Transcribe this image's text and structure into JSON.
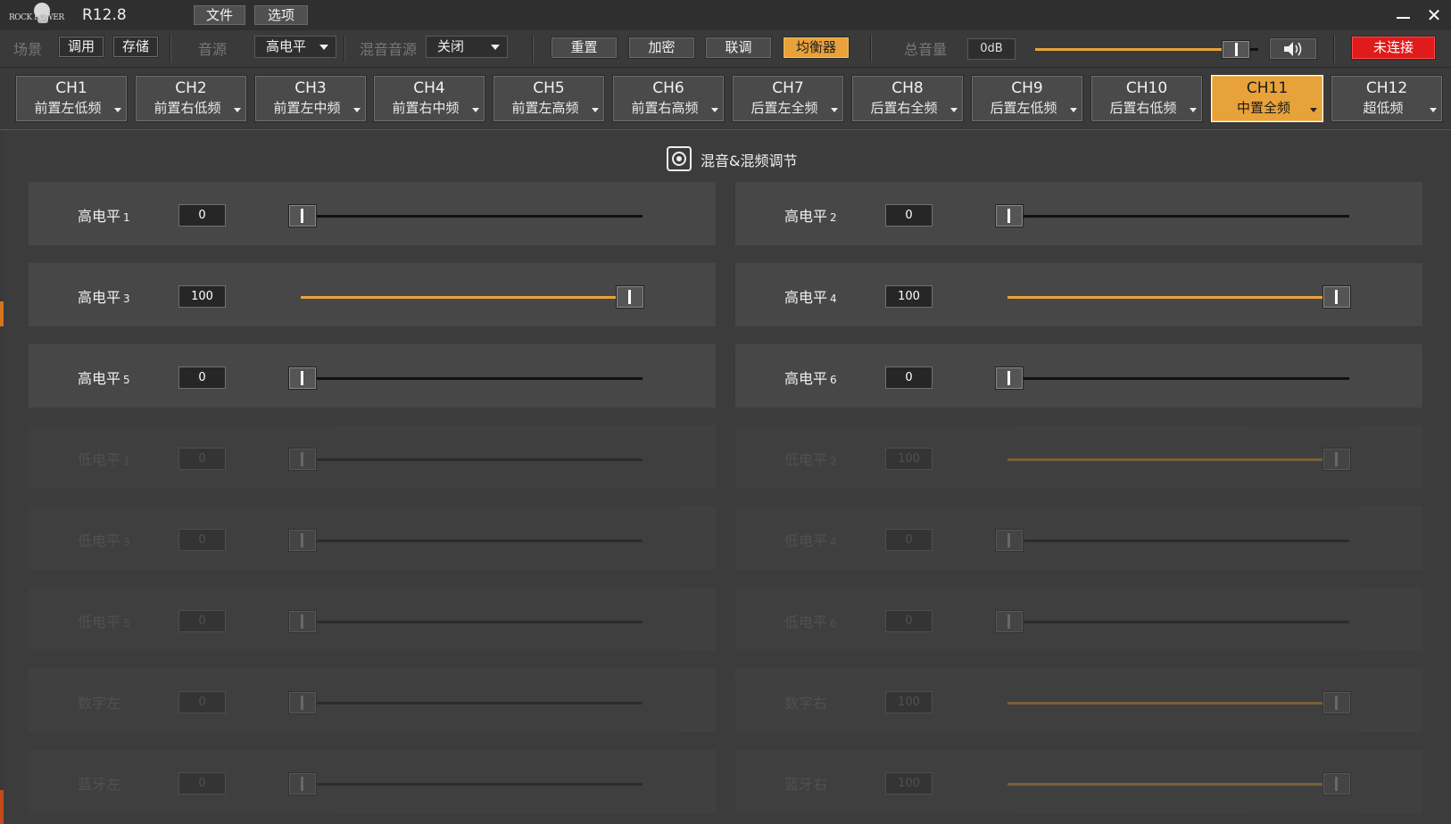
{
  "titlebar": {
    "logo_text": "ROCK POWER",
    "version": "R12.8",
    "menu": [
      "文件",
      "选项"
    ]
  },
  "toolbar": {
    "scene_label": "场景",
    "recall_btn": "调用",
    "store_btn": "存储",
    "source_label": "音源",
    "source_value": "高电平",
    "mix_source_label": "混音音源",
    "mix_source_value": "关闭",
    "reset_btn": "重置",
    "encrypt_btn": "加密",
    "link_btn": "联调",
    "eq_btn": "均衡器",
    "master_volume_label": "总音量",
    "master_volume_value": "0dB",
    "master_volume_level": 0.85,
    "connect_btn": "未连接",
    "colors": {
      "accent": "#e8a23a",
      "danger": "#e11b1b"
    }
  },
  "channels": [
    {
      "name": "CH1",
      "sub": "前置左低频"
    },
    {
      "name": "CH2",
      "sub": "前置右低频"
    },
    {
      "name": "CH3",
      "sub": "前置左中频"
    },
    {
      "name": "CH4",
      "sub": "前置右中频"
    },
    {
      "name": "CH5",
      "sub": "前置左高频"
    },
    {
      "name": "CH6",
      "sub": "前置右高频"
    },
    {
      "name": "CH7",
      "sub": "后置左全频"
    },
    {
      "name": "CH8",
      "sub": "后置右全频"
    },
    {
      "name": "CH9",
      "sub": "后置左低频"
    },
    {
      "name": "CH10",
      "sub": "后置右低频"
    },
    {
      "name": "CH11",
      "sub": "中置全频",
      "active": true
    },
    {
      "name": "CH12",
      "sub": "超低频"
    }
  ],
  "panel": {
    "title": "混音&混频调节",
    "rows": [
      {
        "left": {
          "label": "高电平",
          "num": "1",
          "value": "0",
          "level": 0
        },
        "right": {
          "label": "高电平",
          "num": "2",
          "value": "0",
          "level": 0
        }
      },
      {
        "left": {
          "label": "高电平",
          "num": "3",
          "value": "100",
          "level": 100
        },
        "right": {
          "label": "高电平",
          "num": "4",
          "value": "100",
          "level": 100
        }
      },
      {
        "left": {
          "label": "高电平",
          "num": "5",
          "value": "0",
          "level": 0
        },
        "right": {
          "label": "高电平",
          "num": "6",
          "value": "0",
          "level": 0
        }
      },
      {
        "disabled": true,
        "left": {
          "label": "低电平",
          "num": "1",
          "value": "0",
          "level": 0
        },
        "right": {
          "label": "低电平",
          "num": "2",
          "value": "100",
          "level": 100
        }
      },
      {
        "disabled": true,
        "left": {
          "label": "低电平",
          "num": "3",
          "value": "0",
          "level": 0
        },
        "right": {
          "label": "低电平",
          "num": "4",
          "value": "0",
          "level": 0
        }
      },
      {
        "disabled": true,
        "left": {
          "label": "低电平",
          "num": "5",
          "value": "0",
          "level": 0
        },
        "right": {
          "label": "低电平",
          "num": "6",
          "value": "0",
          "level": 0
        }
      },
      {
        "disabled": true,
        "left": {
          "label": "数字左",
          "num": "",
          "value": "0",
          "level": 0
        },
        "right": {
          "label": "数字右",
          "num": "",
          "value": "100",
          "level": 100
        }
      },
      {
        "disabled": true,
        "left": {
          "label": "蓝牙左",
          "num": "",
          "value": "0",
          "level": 0
        },
        "right": {
          "label": "蓝牙右",
          "num": "",
          "value": "100",
          "level": 100
        }
      }
    ]
  }
}
